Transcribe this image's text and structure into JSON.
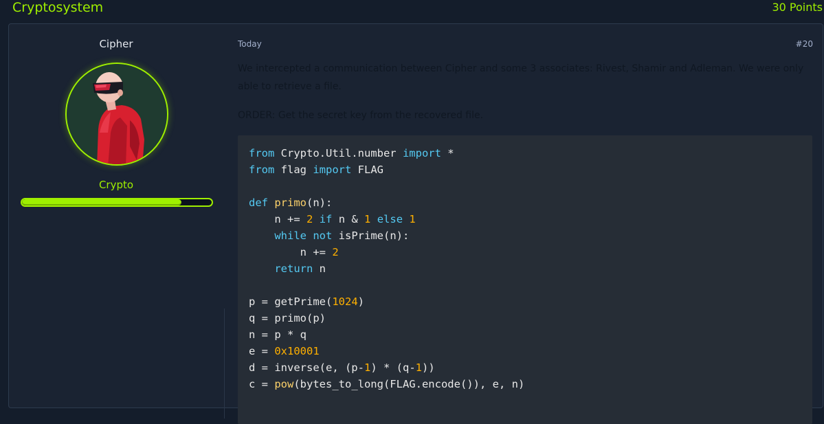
{
  "header": {
    "title": "Cryptosystem",
    "points": "30 Points"
  },
  "author": {
    "name": "Cipher",
    "rank": "Crypto",
    "progress_fraction": 0.84,
    "accent_color": "#9fef00"
  },
  "post": {
    "date": "Today",
    "number": "#20",
    "paragraphs": [
      "We intercepted a communication between Cipher and some 3 associates: Rivest, Shamir and Adleman. We were only able to retrieve a file.",
      "ORDER: Get the secret key from the recovered file."
    ],
    "code_lines": [
      [
        {
          "t": "from",
          "c": "kw"
        },
        {
          "t": " Crypto.Util.number ",
          "c": "id"
        },
        {
          "t": "import",
          "c": "kw"
        },
        {
          "t": " *",
          "c": "id"
        }
      ],
      [
        {
          "t": "from",
          "c": "kw"
        },
        {
          "t": " flag ",
          "c": "id"
        },
        {
          "t": "import",
          "c": "kw"
        },
        {
          "t": " FLAG",
          "c": "id"
        }
      ],
      [],
      [
        {
          "t": "def",
          "c": "kw"
        },
        {
          "t": " ",
          "c": "id"
        },
        {
          "t": "primo",
          "c": "fn"
        },
        {
          "t": "(n):",
          "c": "id"
        }
      ],
      [
        {
          "t": "    n += ",
          "c": "id"
        },
        {
          "t": "2",
          "c": "num"
        },
        {
          "t": " ",
          "c": "id"
        },
        {
          "t": "if",
          "c": "kw"
        },
        {
          "t": " n & ",
          "c": "id"
        },
        {
          "t": "1",
          "c": "num"
        },
        {
          "t": " ",
          "c": "id"
        },
        {
          "t": "else",
          "c": "kw"
        },
        {
          "t": " ",
          "c": "id"
        },
        {
          "t": "1",
          "c": "num"
        }
      ],
      [
        {
          "t": "    ",
          "c": "id"
        },
        {
          "t": "while",
          "c": "kw"
        },
        {
          "t": " ",
          "c": "id"
        },
        {
          "t": "not",
          "c": "kw"
        },
        {
          "t": " isPrime(n):",
          "c": "id"
        }
      ],
      [
        {
          "t": "        n += ",
          "c": "id"
        },
        {
          "t": "2",
          "c": "num"
        }
      ],
      [
        {
          "t": "    ",
          "c": "id"
        },
        {
          "t": "return",
          "c": "kw"
        },
        {
          "t": " n",
          "c": "id"
        }
      ],
      [],
      [
        {
          "t": "p = getPrime(",
          "c": "id"
        },
        {
          "t": "1024",
          "c": "num"
        },
        {
          "t": ")",
          "c": "id"
        }
      ],
      [
        {
          "t": "q = primo(p)",
          "c": "id"
        }
      ],
      [
        {
          "t": "n = p * q",
          "c": "id"
        }
      ],
      [
        {
          "t": "e = ",
          "c": "id"
        },
        {
          "t": "0x10001",
          "c": "num"
        }
      ],
      [
        {
          "t": "d = inverse(e, (p-",
          "c": "id"
        },
        {
          "t": "1",
          "c": "num"
        },
        {
          "t": ") * (q-",
          "c": "id"
        },
        {
          "t": "1",
          "c": "num"
        },
        {
          "t": "))",
          "c": "id"
        }
      ],
      [
        {
          "t": "c = ",
          "c": "id"
        },
        {
          "t": "pow",
          "c": "fn"
        },
        {
          "t": "(bytes_to_long(FLAG.encode()), e, n)",
          "c": "id"
        }
      ]
    ]
  }
}
